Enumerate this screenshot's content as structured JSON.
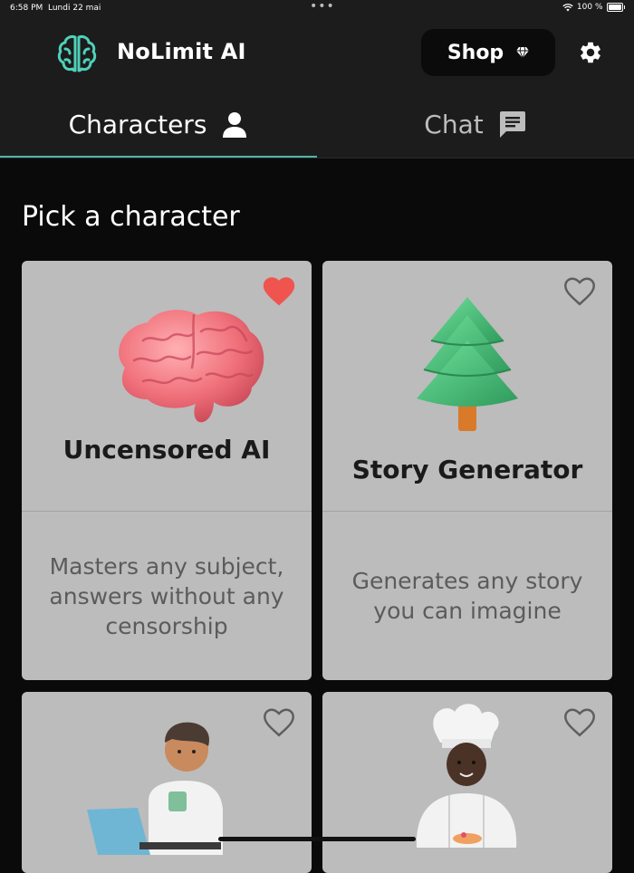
{
  "status_bar": {
    "time": "6:58 PM",
    "date": "Lundi 22 mai",
    "battery": "100 %"
  },
  "header": {
    "app_name": "NoLimit AI",
    "shop_label": "Shop"
  },
  "tabs": [
    {
      "label": "Characters",
      "active": true
    },
    {
      "label": "Chat",
      "active": false
    }
  ],
  "page_title": "Pick a character",
  "characters": [
    {
      "title": "Uncensored AI",
      "description": "Masters any subject, answers without any censorship",
      "favorite": true,
      "image": "brain-illustration"
    },
    {
      "title": "Story Generator",
      "description": "Generates any story you can imagine",
      "favorite": false,
      "image": "tree-illustration"
    },
    {
      "title": "",
      "description": "",
      "favorite": false,
      "image": "person-laptop-illustration"
    },
    {
      "title": "",
      "description": "",
      "favorite": false,
      "image": "chef-illustration"
    }
  ],
  "colors": {
    "accent": "#4fb3a9",
    "heart": "#f0544f",
    "card": "#bcbcbc"
  }
}
